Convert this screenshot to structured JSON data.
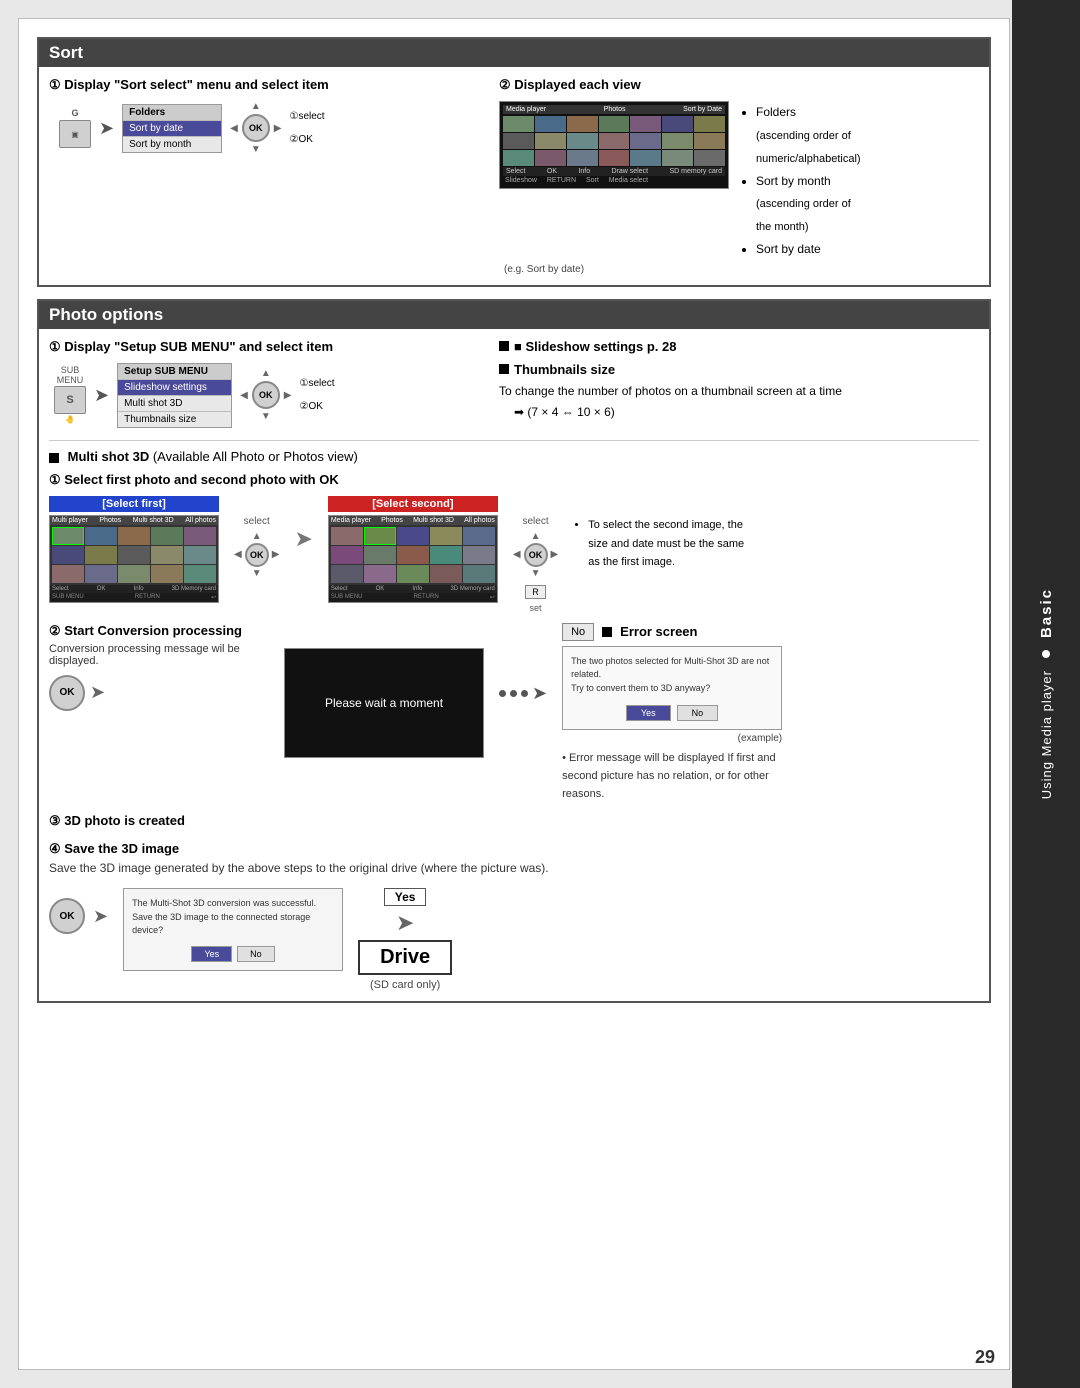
{
  "page": {
    "number": "29"
  },
  "sidebar": {
    "basic_label": "Basic",
    "using_label": "Using Media player"
  },
  "sort_section": {
    "title": "Sort",
    "step1_title": "① Display \"Sort select\" menu and select item",
    "step2_title": "② Displayed each view",
    "menu_items": [
      "Folders",
      "Sort by date",
      "Sort by month"
    ],
    "highlighted_item": "Sort by date",
    "select_label": "①select",
    "ok_label": "②OK",
    "eg_label": "(e.g. Sort by date)",
    "bullet_folders": "Folders (ascending order of numeric/alphabetical)",
    "bullet_month": "Sort by month (ascending order of the month)",
    "bullet_date": "Sort by date"
  },
  "photo_options_section": {
    "title": "Photo options",
    "step1_title": "① Display \"Setup SUB MENU\" and select item",
    "menu_items": [
      "Setup SUB MENU",
      "Slideshow settings",
      "Multi shot 3D",
      "Thumbnails size"
    ],
    "select_label": "①select",
    "ok_label": "②OK",
    "slideshow_title": "■ Slideshow settings p. 28",
    "thumbnails_title": "■ Thumbnails size",
    "thumbnails_desc": "To change the number of photos on a thumbnail screen at a time",
    "thumbnails_formula": "➡ (7 × 4 ⇔ 10 × 6)",
    "multishot_label": "■ Multi shot 3D",
    "multishot_note": "(Available All Photo or Photos view)",
    "select_first_title": "① Select first photo and second photo with OK",
    "select_first_label": "[Select first]",
    "select_second_label": "[Select second]",
    "select_label2": "select",
    "set_label": "set",
    "start_conversion_title": "② Start Conversion processing",
    "start_conversion_desc": "Conversion processing message wil be displayed.",
    "wait_message": "Please wait a moment",
    "no_label": "No",
    "error_screen_title": "■ Error screen",
    "error_text": "The two photos selected for Multi-Shot 3D are not related. Try to convert them to 3D anyway?",
    "error_yes": "Yes",
    "error_no": "No",
    "example_label": "(example)",
    "error_note": "• Error message will be displayed If first and second picture has no relation, or for other reasons.",
    "step3_title": "③ 3D photo is created",
    "step4_title": "④ Save the 3D image",
    "save_desc": "Save the 3D image generated by the above steps to the original drive (where the picture was).",
    "save_dialog_text": "The Multi-Shot 3D conversion was successful. Save the 3D image to the connected storage device?",
    "save_yes": "Yes",
    "save_no": "No",
    "yes_label": "Yes",
    "drive_label": "Drive",
    "sd_only": "(SD card only)"
  }
}
